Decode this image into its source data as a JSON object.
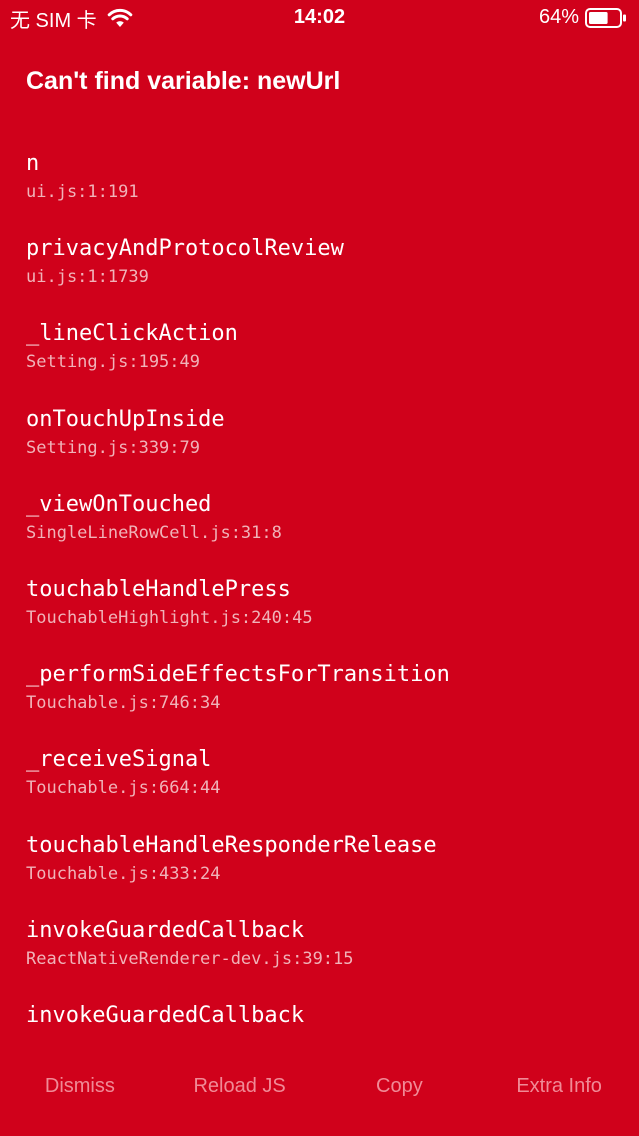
{
  "status_bar": {
    "carrier": "无 SIM 卡",
    "time": "14:02",
    "battery_percent": "64%",
    "battery_level": 0.64,
    "icons": [
      "wifi-icon",
      "battery-icon"
    ]
  },
  "error": {
    "title": "Can't find variable: newUrl"
  },
  "stack": [
    {
      "method": "n",
      "location": "ui.js:1:191"
    },
    {
      "method": "privacyAndProtocolReview",
      "location": "ui.js:1:1739"
    },
    {
      "method": "_lineClickAction",
      "location": "Setting.js:195:49"
    },
    {
      "method": "onTouchUpInside",
      "location": "Setting.js:339:79"
    },
    {
      "method": "_viewOnTouched",
      "location": "SingleLineRowCell.js:31:8"
    },
    {
      "method": "touchableHandlePress",
      "location": "TouchableHighlight.js:240:45"
    },
    {
      "method": "_performSideEffectsForTransition",
      "location": "Touchable.js:746:34"
    },
    {
      "method": "_receiveSignal",
      "location": "Touchable.js:664:44"
    },
    {
      "method": "touchableHandleResponderRelease",
      "location": "Touchable.js:433:24"
    },
    {
      "method": "invokeGuardedCallback",
      "location": "ReactNativeRenderer-dev.js:39:15"
    },
    {
      "method": "invokeGuardedCallback",
      "location": ""
    }
  ],
  "toolbar": {
    "dismiss_label": "Dismiss",
    "reload_label": "Reload JS",
    "copy_label": "Copy",
    "extra_label": "Extra Info"
  },
  "colors": {
    "background": "#D0011B",
    "text": "#FFFFFF",
    "location_text": "#F0B3B9",
    "button_text": "#F08A96"
  }
}
